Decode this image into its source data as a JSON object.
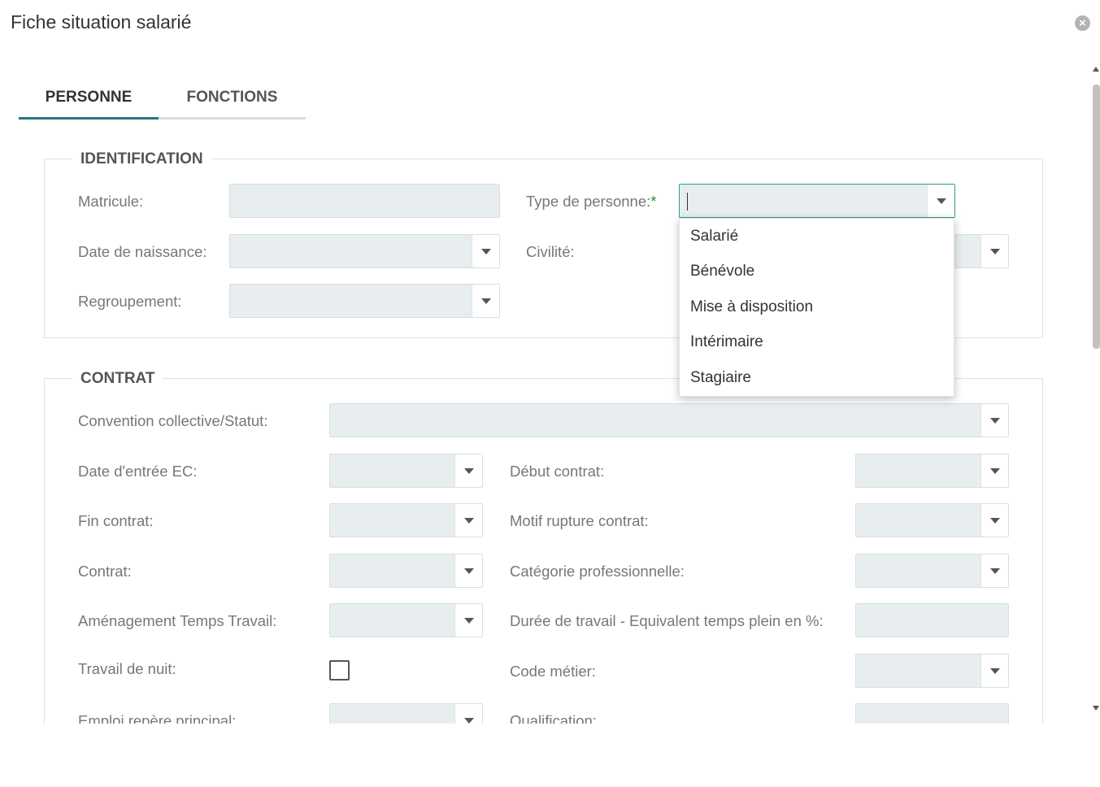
{
  "dialog": {
    "title": "Fiche situation salarié"
  },
  "tabs": [
    {
      "label": "PERSONNE"
    },
    {
      "label": "FONCTIONS"
    }
  ],
  "identification": {
    "legend": "IDENTIFICATION",
    "matricule_label": "Matricule:",
    "type_personne_label": "Type de personne:",
    "required_mark": "*",
    "date_naissance_label": "Date de naissance:",
    "civilite_label": "Civilité:",
    "regroupement_label": "Regroupement:"
  },
  "type_personne_options": [
    "Salarié",
    "Bénévole",
    "Mise à disposition",
    "Intérimaire",
    "Stagiaire"
  ],
  "contrat": {
    "legend": "CONTRAT",
    "convention_label": "Convention collective/Statut:",
    "date_entree_label": "Date d'entrée EC:",
    "debut_contrat_label": "Début contrat:",
    "fin_contrat_label": "Fin contrat:",
    "motif_rupture_label": "Motif rupture contrat:",
    "contrat_label": "Contrat:",
    "categorie_label": "Catégorie professionnelle:",
    "amenagement_label": "Aménagement Temps Travail:",
    "duree_travail_label": "Durée de travail - Equivalent temps plein en %:",
    "travail_nuit_label": "Travail de nuit:",
    "code_metier_label": "Code métier:",
    "emploi_repere_label": "Emploi repère principal:",
    "qualification_label": "Qualification:"
  }
}
